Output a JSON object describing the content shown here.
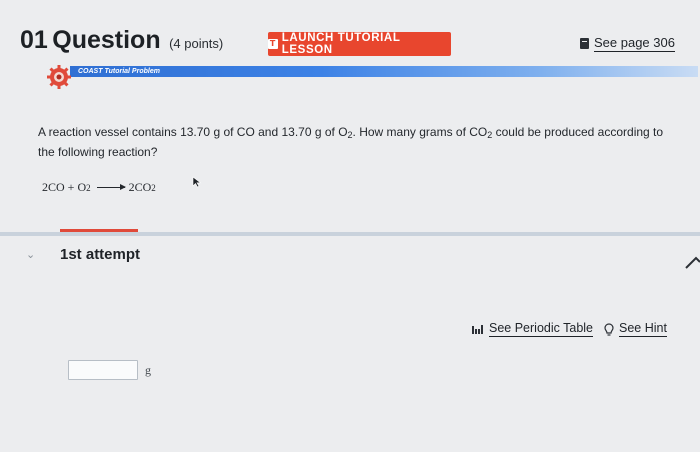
{
  "header": {
    "question_number": "01",
    "question_word": "Question",
    "points": "(4 points)",
    "launch_label": "LAUNCH TUTORIAL LESSON",
    "launch_icon_glyph": "T",
    "see_page_label": "See page 306"
  },
  "banner": {
    "label": "COAST Tutorial Problem",
    "bar_color": "#3d82e6"
  },
  "question": {
    "line1_a": "A reaction vessel contains 13.70 g of CO and 13.70 g of O",
    "line1_b": ". How many grams of CO",
    "line1_c": " could be produced according to the following reaction?",
    "sub2": "2"
  },
  "equation": {
    "left": "2CO + O",
    "sub": "2",
    "right": "2CO"
  },
  "attempt": {
    "chevron": "⌄",
    "label": "1st attempt"
  },
  "tools": {
    "periodic_label": "See Periodic Table",
    "hint_label": "See Hint"
  },
  "answer": {
    "value": "",
    "unit": "g"
  },
  "colors": {
    "accent_red": "#e8462e",
    "divider": "#c9d2dc",
    "background": "#ecedef"
  }
}
